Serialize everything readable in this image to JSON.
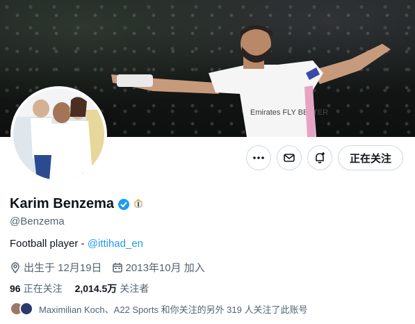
{
  "profile": {
    "name": "Karim Benzema",
    "handle": "@Benzema",
    "bio_text": "Football player - ",
    "bio_link": "@ittihad_en",
    "birthday": "出生于 12月19日",
    "joined": "2013年10月 加入",
    "following_count": "96",
    "following_label": "正在关注",
    "followers_count": "2,014.5万",
    "followers_label": "关注者",
    "followed_by": "Maximilian Koch、A22 Sports 和你关注的另外 319 人关注了此账号"
  },
  "actions": {
    "follow_state": "正在关注"
  },
  "banner": {
    "jersey_text": "Emirates FLY BETTER"
  },
  "icons": {
    "more": "more-icon",
    "message": "mail-icon",
    "notify": "bell-plus-icon",
    "verified": "verified-badge-icon",
    "location": "location-icon",
    "calendar": "calendar-icon"
  },
  "colors": {
    "accent": "#1d9bf0",
    "text": "#0f1419",
    "muted": "#536471"
  }
}
